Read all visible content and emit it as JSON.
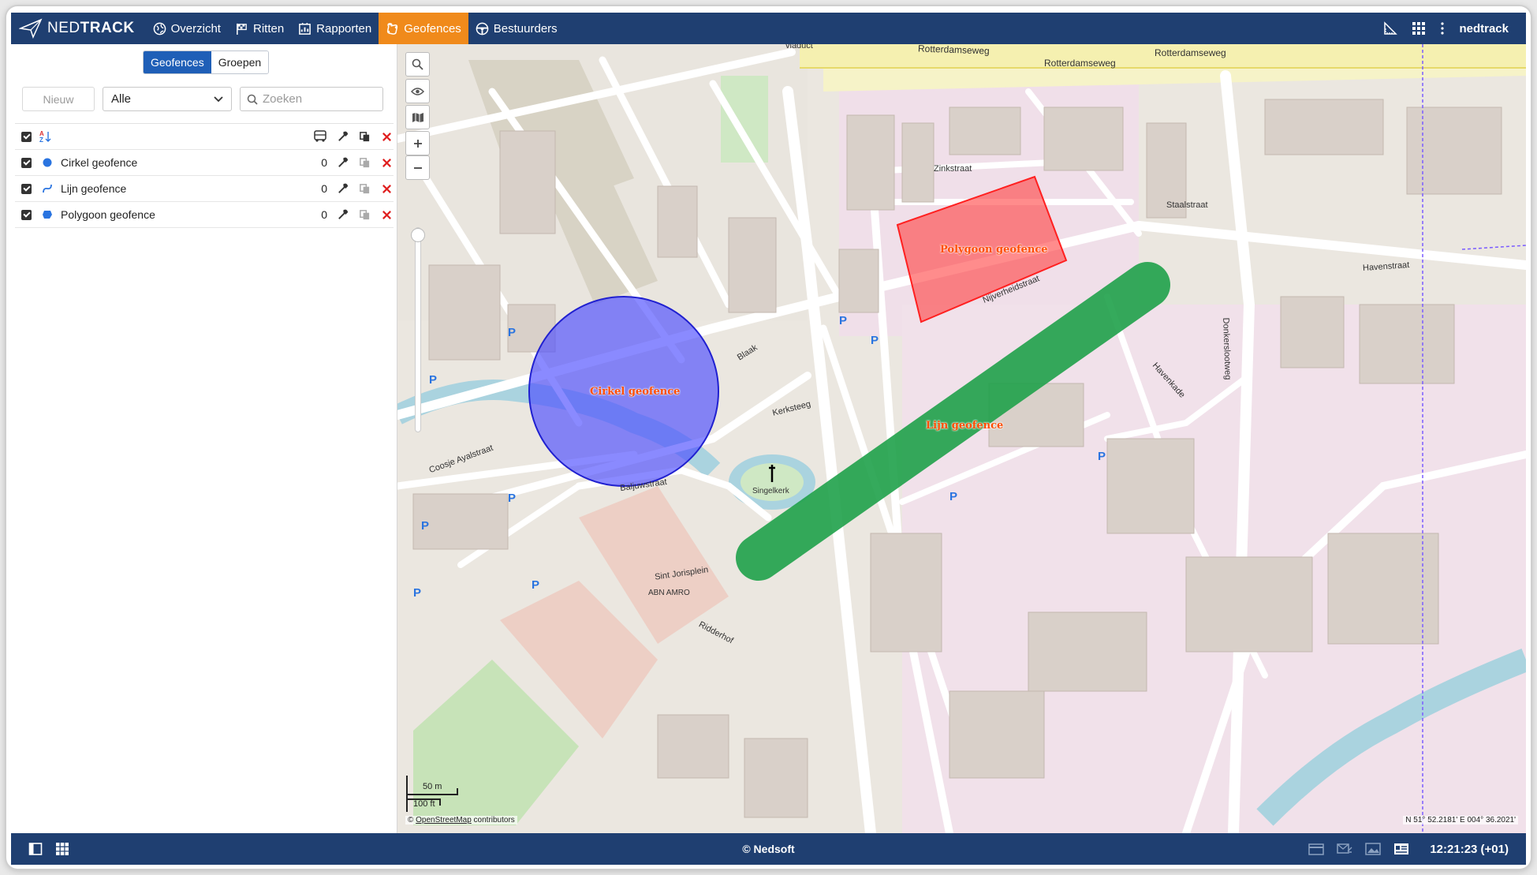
{
  "app": {
    "brand_bold": "NED",
    "brand_rest": "TRACK",
    "username": "nedtrack"
  },
  "nav": {
    "items": [
      {
        "label": "Overzicht",
        "icon": "globe-icon"
      },
      {
        "label": "Ritten",
        "icon": "flag-icon"
      },
      {
        "label": "Rapporten",
        "icon": "report-icon"
      },
      {
        "label": "Geofences",
        "icon": "geofence-icon",
        "active": true
      },
      {
        "label": "Bestuurders",
        "icon": "steering-wheel-icon"
      }
    ]
  },
  "sidebar": {
    "tabs": {
      "geofences": "Geofences",
      "groepen": "Groepen"
    },
    "new_button": "Nieuw",
    "filter_value": "Alle",
    "search_placeholder": "Zoeken",
    "sort_icon_label": "A-Z",
    "geofences": [
      {
        "name": "Cirkel geofence",
        "count": "0",
        "type": "circle",
        "color": "#2a74e0"
      },
      {
        "name": "Lijn geofence",
        "count": "0",
        "type": "line",
        "color": "#2a74e0"
      },
      {
        "name": "Polygoon geofence",
        "count": "0",
        "type": "polygon",
        "color": "#2a74e0"
      }
    ]
  },
  "map": {
    "geofence_labels": {
      "circle": "Cirkel geofence",
      "line": "Lijn geofence",
      "polygon": "Polygoon geofence"
    },
    "colors": {
      "circle": "#4b4bff",
      "line": "#1fa14a",
      "polygon": "#ff4040"
    },
    "scale_metric": "50 m",
    "scale_imperial": "100 ft",
    "attribution_prefix": "©",
    "attribution_link": "OpenStreetMap",
    "attribution_suffix": "contributors",
    "coordinates": "N 51° 52.2181' E 004° 36.2021'",
    "street_labels": {
      "rotterdamseweg": "Rotterdamseweg",
      "viaduct": "viaduct",
      "zinkstraat": "Zinkstraat",
      "staalstraat": "Staalstraat",
      "havenstraat": "Havenstraat",
      "nijverheidstraat": "Nijverheidstraat",
      "kerksteeg": "Kerksteeg",
      "singelkerk": "Singelkerk",
      "baljuwstraat": "Baljuwstraat",
      "sint_jorisplein": "Sint Jorisplein",
      "coosje": "Coosje Ayalstraat",
      "donkerslootweg": "Donkerslootweg",
      "blaak": "Blaak",
      "ridderhof": "Ridderhof",
      "havenkade": "Havenkade",
      "abn_amro": "ABN AMRO"
    }
  },
  "footer": {
    "copyright": "© Nedsoft",
    "time": "12:21:23 (+01)"
  }
}
